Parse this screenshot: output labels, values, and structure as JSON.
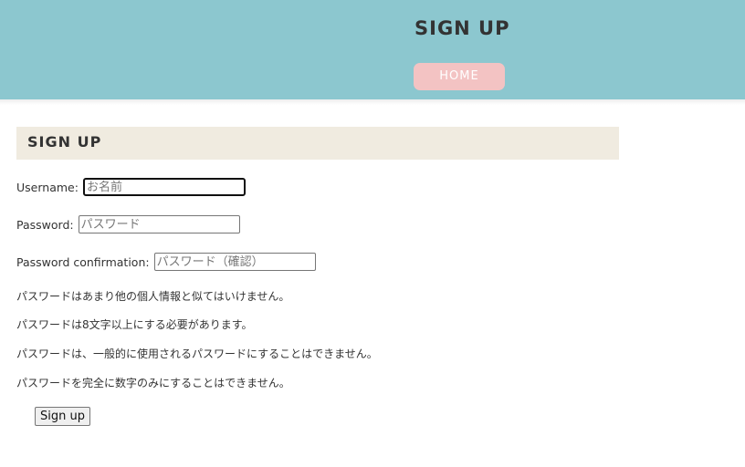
{
  "header": {
    "title": "SIGN UP",
    "home_label": "HOME"
  },
  "section": {
    "title": "SIGN UP"
  },
  "form": {
    "username": {
      "label": "Username:",
      "placeholder": "お名前"
    },
    "password": {
      "label": "Password:",
      "placeholder": "パスワード"
    },
    "password_confirmation": {
      "label": "Password confirmation:",
      "placeholder": "パスワード（確認）"
    },
    "help": [
      "パスワードはあまり他の個人情報と似てはいけません。",
      "パスワードは8文字以上にする必要があります。",
      "パスワードは、一般的に使用されるパスワードにすることはできません。",
      "パスワードを完全に数字のみにすることはできません。"
    ],
    "submit_label": "Sign up"
  },
  "colors": {
    "header_bg": "#8cc7cf",
    "home_button_bg": "#f3c3c3",
    "section_bg": "#f0ebe0"
  }
}
